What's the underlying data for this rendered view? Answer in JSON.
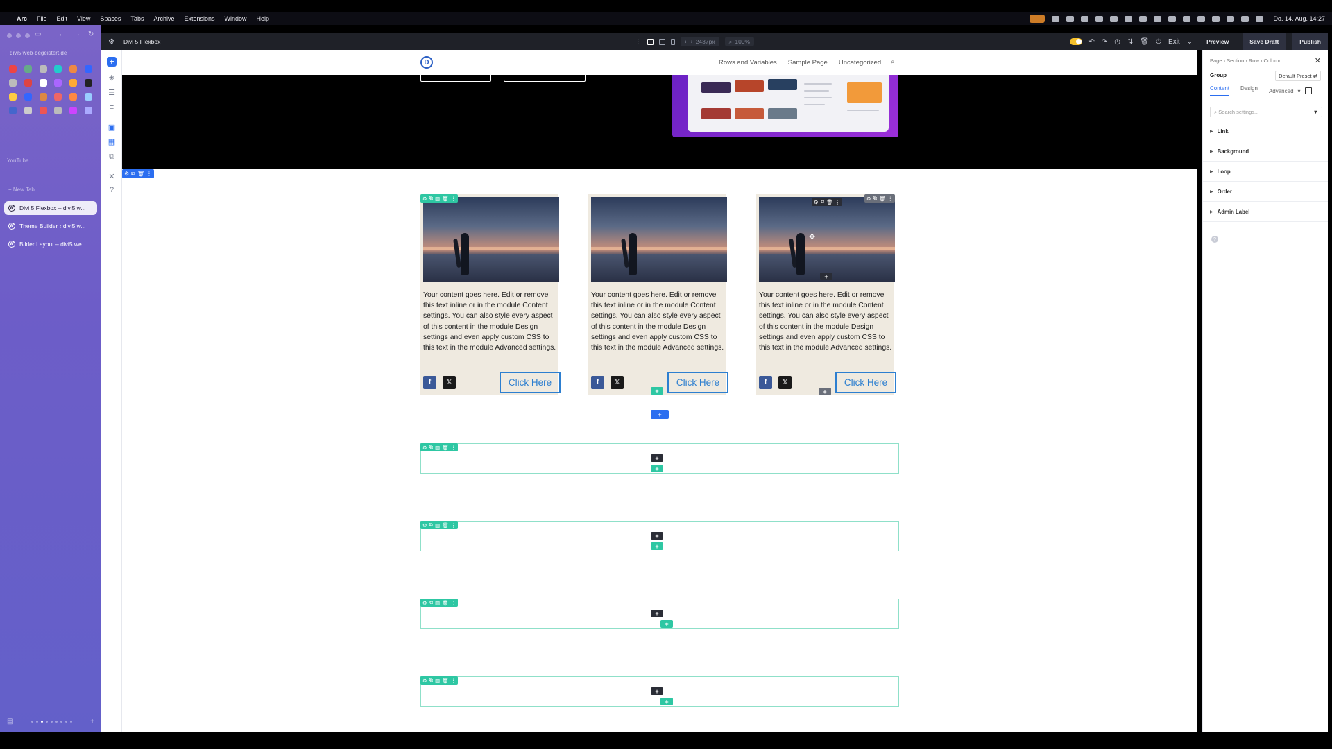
{
  "menubar": {
    "app": "Arc",
    "items": [
      "File",
      "Edit",
      "View",
      "Spaces",
      "Tabs",
      "Archive",
      "Extensions",
      "Window",
      "Help"
    ],
    "clock": "Do. 14. Aug.  14:27"
  },
  "arc": {
    "url": "divi5.web-begeistert.de",
    "section_label": "YouTube",
    "new_tab": "+ New Tab",
    "tabs": [
      {
        "label": "Divi 5 Flexbox – divi5.w...",
        "active": true
      },
      {
        "label": "Theme Builder ‹ divi5.w...",
        "active": false
      },
      {
        "label": "Bilder Layout – divi5.we...",
        "active": false
      }
    ],
    "favorite_colors": [
      "#e44",
      "#6a8",
      "#bbb",
      "#2cc",
      "#e84",
      "#36f",
      "#bbb",
      "#d44",
      "#fff",
      "#a6f",
      "#fa3",
      "#222",
      "#fc4",
      "#36f",
      "#d84",
      "#e66",
      "#f84",
      "#9cf",
      "#46c",
      "#ccc",
      "#e55",
      "#bbb",
      "#c4f",
      "#aaf"
    ]
  },
  "divibar": {
    "title": "Divi 5 Flexbox",
    "width_value": "2437px",
    "zoom_value": "100%",
    "exit": "Exit",
    "preview": "Preview",
    "save_draft": "Save Draft",
    "publish": "Publish"
  },
  "site": {
    "logo": "D",
    "nav": [
      "Rows and Variables",
      "Sample Page",
      "Uncategorized"
    ]
  },
  "cards": [
    {
      "text": "Your content goes here. Edit or remove this text inline or in the module Content settings. You can also style every aspect of this content in the module Design settings and even apply custom CSS to this text in the module Advanced settings.",
      "button": "Click Here"
    },
    {
      "text": "Your content goes here. Edit or remove this text inline or in the module Content settings. You can also style every aspect of this content in the module Design settings and even apply custom CSS to this text in the module Advanced settings.",
      "button": "Click Here"
    },
    {
      "text": "Your content goes here. Edit or remove this text inline or in the module Content settings. You can also style every aspect of this content in the module Design settings and even apply custom CSS to this text in the module Advanced settings.",
      "button": "Click Here"
    }
  ],
  "social": {
    "facebook": "f",
    "x": "𝕏"
  },
  "panel": {
    "breadcrumb": "Page  ›  Section  ›  Row  ›  Column",
    "title": "Group",
    "preset": "Default Preset ⇄",
    "tabs": {
      "content": "Content",
      "design": "Design",
      "advanced": "Advanced"
    },
    "search_placeholder": "Search settings...",
    "groups": [
      "Link",
      "Background",
      "Loop",
      "Order",
      "Admin Label"
    ]
  },
  "colors": {
    "divi_blue": "#2b6ef0",
    "module_green": "#2ec7a3",
    "button_blue": "#2d7fd0",
    "arc_purple": "#6d5dc8"
  }
}
